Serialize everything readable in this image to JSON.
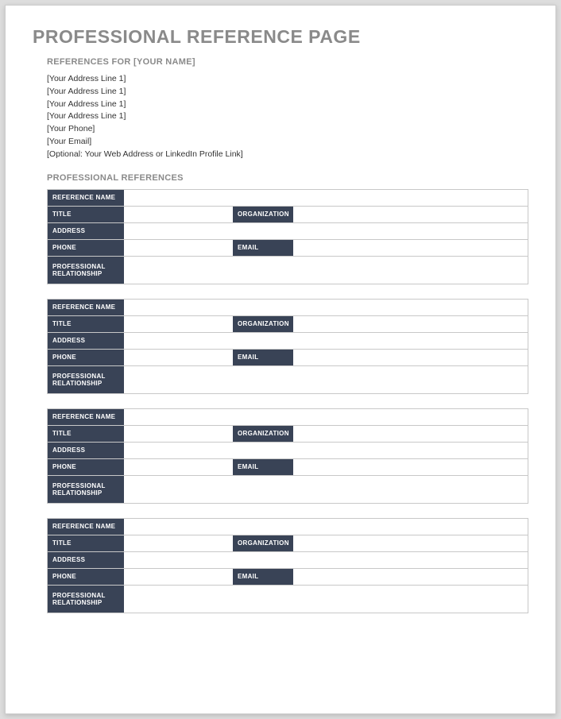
{
  "title": "PROFESSIONAL REFERENCE PAGE",
  "subheader": "REFERENCES FOR [YOUR NAME]",
  "address_lines": [
    "[Your Address Line 1]",
    "[Your Address Line 1]",
    "[Your Address Line 1]",
    "[Your Address Line 1]",
    "[Your Phone]",
    "[Your Email]",
    "[Optional: Your Web Address or LinkedIn Profile Link]"
  ],
  "section_header": "PROFESSIONAL REFERENCES",
  "labels": {
    "reference_name": "REFERENCE NAME",
    "title": "TITLE",
    "organization": "ORGANIZATION",
    "address": "ADDRESS",
    "phone": "PHONE",
    "email": "EMAIL",
    "professional_relationship": "PROFESSIONAL RELATIONSHIP"
  },
  "references": [
    {
      "reference_name": "",
      "title": "",
      "organization": "",
      "address": "",
      "phone": "",
      "email": "",
      "professional_relationship": ""
    },
    {
      "reference_name": "",
      "title": "",
      "organization": "",
      "address": "",
      "phone": "",
      "email": "",
      "professional_relationship": ""
    },
    {
      "reference_name": "",
      "title": "",
      "organization": "",
      "address": "",
      "phone": "",
      "email": "",
      "professional_relationship": ""
    },
    {
      "reference_name": "",
      "title": "",
      "organization": "",
      "address": "",
      "phone": "",
      "email": "",
      "professional_relationship": ""
    }
  ]
}
